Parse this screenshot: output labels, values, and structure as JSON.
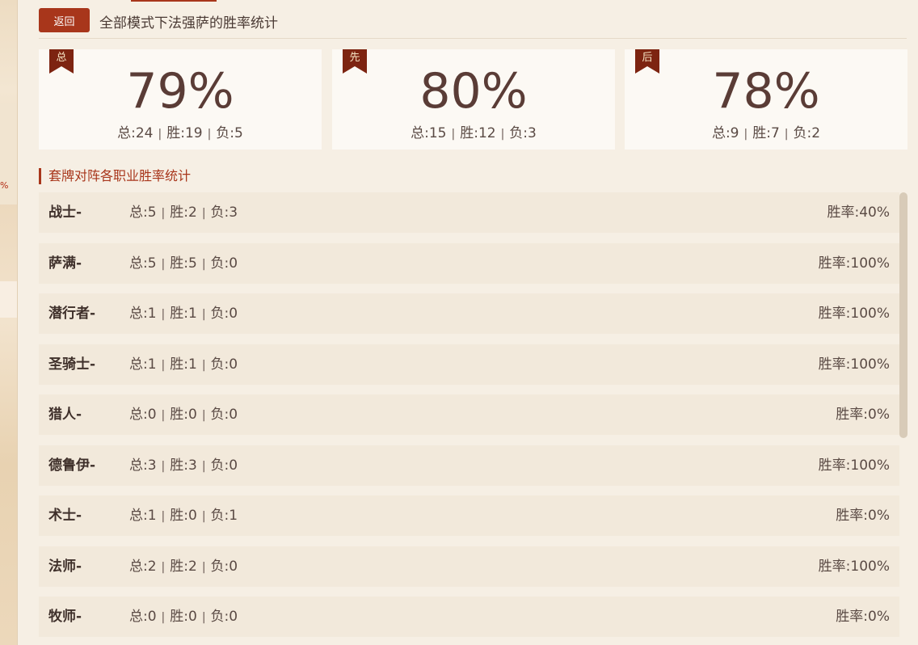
{
  "left_strip": {
    "mark": "%"
  },
  "header": {
    "back_label": "返回",
    "title": "全部模式下法强萨的胜率统计"
  },
  "stats": [
    {
      "badge": "总",
      "percent": "79%",
      "total": "总:24",
      "win": "胜:19",
      "loss": "负:5"
    },
    {
      "badge": "先",
      "percent": "80%",
      "total": "总:15",
      "win": "胜:12",
      "loss": "负:3"
    },
    {
      "badge": "后",
      "percent": "78%",
      "total": "总:9",
      "win": "胜:7",
      "loss": "负:2"
    }
  ],
  "separator": "|",
  "section_title": "套牌对阵各职业胜率统计",
  "rows": [
    {
      "name": "战士-",
      "total": "总:5",
      "win": "胜:2",
      "loss": "负:3",
      "rate": "胜率:40%"
    },
    {
      "name": "萨满-",
      "total": "总:5",
      "win": "胜:5",
      "loss": "负:0",
      "rate": "胜率:100%"
    },
    {
      "name": "潜行者-",
      "total": "总:1",
      "win": "胜:1",
      "loss": "负:0",
      "rate": "胜率:100%"
    },
    {
      "name": "圣骑士-",
      "total": "总:1",
      "win": "胜:1",
      "loss": "负:0",
      "rate": "胜率:100%"
    },
    {
      "name": "猎人-",
      "total": "总:0",
      "win": "胜:0",
      "loss": "负:0",
      "rate": "胜率:0%"
    },
    {
      "name": "德鲁伊-",
      "total": "总:3",
      "win": "胜:3",
      "loss": "负:0",
      "rate": "胜率:100%"
    },
    {
      "name": "术士-",
      "total": "总:1",
      "win": "胜:0",
      "loss": "负:1",
      "rate": "胜率:0%"
    },
    {
      "name": "法师-",
      "total": "总:2",
      "win": "胜:2",
      "loss": "负:0",
      "rate": "胜率:100%"
    },
    {
      "name": "牧师-",
      "total": "总:0",
      "win": "胜:0",
      "loss": "负:0",
      "rate": "胜率:0%"
    }
  ]
}
